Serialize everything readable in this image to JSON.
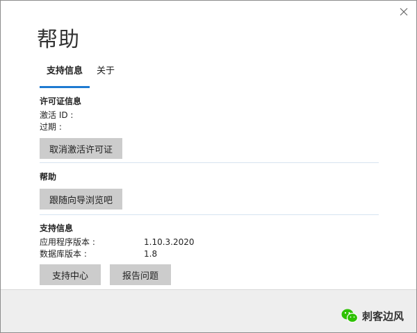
{
  "window": {
    "title": "帮助"
  },
  "tabs": [
    {
      "label": "支持信息"
    },
    {
      "label": "关于"
    }
  ],
  "license": {
    "title": "许可证信息",
    "activation_label": "激活 ID :",
    "expiry_label": "过期 :",
    "deactivate_button": "取消激活许可证"
  },
  "help": {
    "title": "帮助",
    "tour_button": "跟随向导浏览吧"
  },
  "support": {
    "title": "支持信息",
    "rows": [
      {
        "label": "应用程序版本 :",
        "value": "1.10.3.2020"
      },
      {
        "label": "数据库版本 :",
        "value": "1.8"
      }
    ],
    "center_button": "支持中心",
    "report_button": "报告问题"
  },
  "footer": {
    "brand_text": "刺客边风"
  },
  "colors": {
    "accent": "#1e7ad1",
    "button_bg": "#cccccc",
    "footer_bg": "#eeeeee",
    "wechat_green": "#2dc100"
  },
  "icons": {
    "close": "close-icon",
    "brand": "wechat-icon"
  }
}
